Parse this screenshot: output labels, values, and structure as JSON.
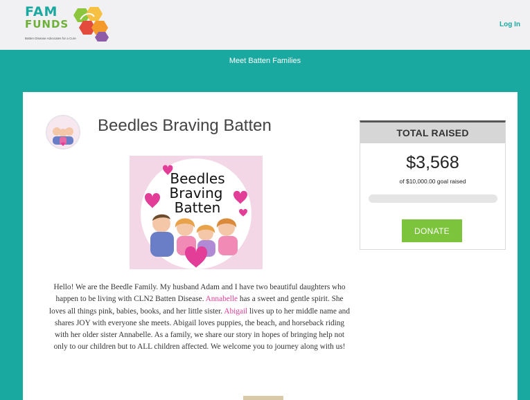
{
  "header": {
    "logo_line1": "FAM",
    "logo_line2": "FUNDS",
    "logo_tagline": "Batten Disease Advocates for a Cure",
    "login_label": "Log In"
  },
  "nav": {
    "link_label": "Meet Batten Families"
  },
  "page": {
    "title": "Beedles Braving Batten",
    "hero_text": [
      "Beedles",
      "Braving",
      "Batten"
    ],
    "story_parts": [
      "Hello! We are the Beedle Family. My husband Adam and I have two beautiful daughters who happen to be living with CLN2 Batten Disease. ",
      "Annabelle",
      " has a sweet and gentle spirit. She loves all things pink, babies, books, and her little sister. ",
      "Abigail",
      " lives up to her middle name and shares JOY with everyone she meets. Abigail loves puppies, the beach, and horseback riding with her older sister Annabelle. As a family, we share our story in hopes of bringing help not only to our children but to ALL children affected. We welcome you to journey along with us!"
    ]
  },
  "donation": {
    "heading": "TOTAL RAISED",
    "amount": "$3,568",
    "goal_text": "of $10,000.00 goal raised",
    "progress_fraction": 0.0,
    "donate_label": "DONATE"
  },
  "colors": {
    "brand_teal": "#1aa9a1",
    "donate_green": "#7cc43c",
    "name_pink": "#e23d97"
  }
}
